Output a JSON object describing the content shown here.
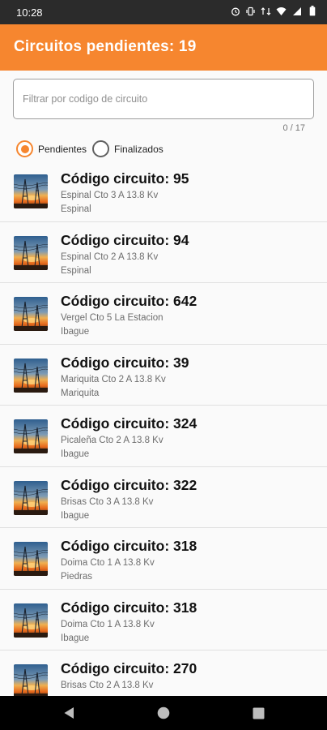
{
  "status_bar": {
    "time": "10:28",
    "icons": [
      "alarm-icon",
      "vibrate-icon",
      "data-icon",
      "wifi-icon",
      "signal-icon",
      "battery-icon"
    ]
  },
  "app_bar": {
    "title": "Circuitos pendientes: 19",
    "color": "#f6862f"
  },
  "filter": {
    "placeholder": "Filtrar por codigo de circuito",
    "value": "",
    "counter": "0 / 17"
  },
  "radio": {
    "options": [
      {
        "label": "Pendientes",
        "selected": true
      },
      {
        "label": "Finalizados",
        "selected": false
      }
    ]
  },
  "circuits": [
    {
      "title": "Código circuito: 95",
      "description": "Espinal Cto 3 A 13.8 Kv",
      "city": "Espinal"
    },
    {
      "title": "Código circuito: 94",
      "description": "Espinal Cto 2 A 13.8 Kv",
      "city": "Espinal"
    },
    {
      "title": "Código circuito: 642",
      "description": "Vergel Cto 5 La Estacion",
      "city": "Ibague"
    },
    {
      "title": "Código circuito: 39",
      "description": "Mariquita Cto 2 A 13.8 Kv",
      "city": "Mariquita"
    },
    {
      "title": "Código circuito: 324",
      "description": "Picaleña Cto 2 A 13.8 Kv",
      "city": "Ibague"
    },
    {
      "title": "Código circuito: 322",
      "description": "Brisas Cto 3 A 13.8 Kv",
      "city": "Ibague"
    },
    {
      "title": "Código circuito: 318",
      "description": "Doima Cto 1 A 13.8 Kv",
      "city": "Piedras"
    },
    {
      "title": "Código circuito: 318",
      "description": "Doima Cto 1 A 13.8 Kv",
      "city": "Ibague"
    },
    {
      "title": "Código circuito: 270",
      "description": "Brisas Cto 2 A 13.8 Kv",
      "city": ""
    }
  ],
  "nav_bar": {
    "buttons": [
      "back-icon",
      "home-icon",
      "recents-icon"
    ]
  }
}
